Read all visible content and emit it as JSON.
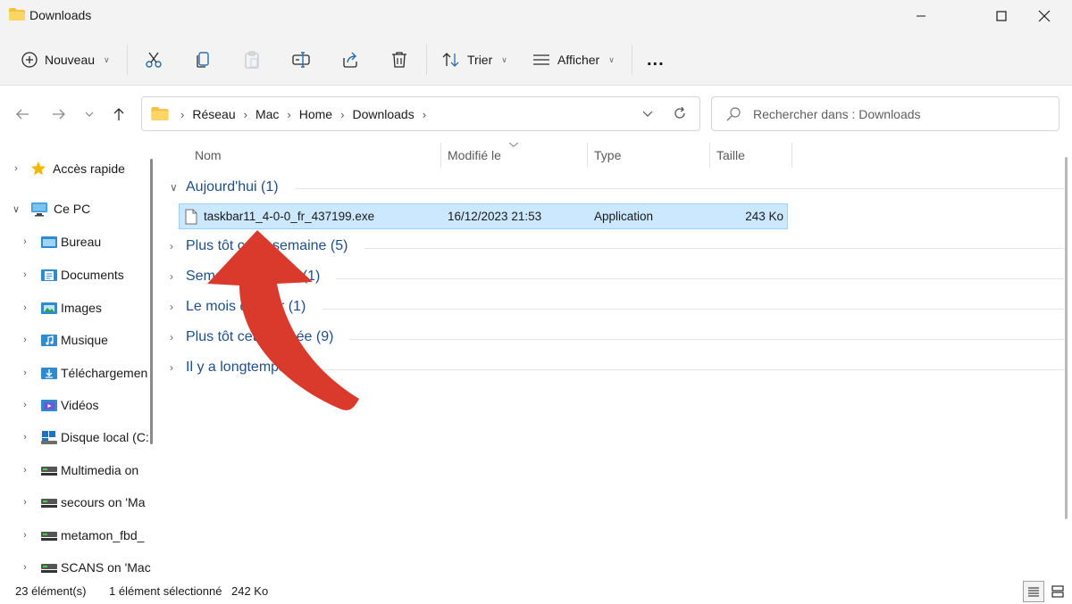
{
  "window": {
    "title": "Downloads",
    "icon": "folder-icon"
  },
  "toolbar": {
    "new_label": "Nouveau",
    "sort_label": "Trier",
    "view_label": "Afficher",
    "more_label": "..."
  },
  "address": {
    "breadcrumbs": [
      "Réseau",
      "Mac",
      "Home",
      "Downloads"
    ]
  },
  "search": {
    "placeholder": "Rechercher dans : Downloads"
  },
  "sidebar": {
    "items": [
      {
        "label": "Accès rapide",
        "icon": "star-icon"
      },
      {
        "label": "Ce PC",
        "icon": "pc-icon"
      },
      {
        "label": "Bureau",
        "icon": "desktop-folder-icon"
      },
      {
        "label": "Documents",
        "icon": "documents-folder-icon"
      },
      {
        "label": "Images",
        "icon": "images-folder-icon"
      },
      {
        "label": "Musique",
        "icon": "music-folder-icon"
      },
      {
        "label": "Téléchargemen",
        "icon": "downloads-folder-icon"
      },
      {
        "label": "Vidéos",
        "icon": "videos-folder-icon"
      },
      {
        "label": "Disque local (C:",
        "icon": "drive-icon"
      },
      {
        "label": "Multimedia on",
        "icon": "network-drive-icon"
      },
      {
        "label": "secours on 'Ma",
        "icon": "network-drive-icon"
      },
      {
        "label": "metamon_fbd_",
        "icon": "network-drive-icon"
      },
      {
        "label": "SCANS on 'Mac",
        "icon": "network-drive-icon"
      }
    ]
  },
  "columns": {
    "name": "Nom",
    "modified": "Modifié le",
    "type": "Type",
    "size": "Taille"
  },
  "groups": [
    {
      "label": "Aujourd'hui (1)",
      "expanded": true
    },
    {
      "label": "Plus tôt cette semaine (5)",
      "expanded": false
    },
    {
      "label": "Semaine dernière (1)",
      "expanded": false
    },
    {
      "label": "Le mois dernier (1)",
      "expanded": false
    },
    {
      "label": "Plus tôt cette année (9)",
      "expanded": false
    },
    {
      "label": "Il y a longtemps (5)",
      "expanded": false
    }
  ],
  "files": [
    {
      "name": "taskbar11_4-0-0_fr_437199.exe",
      "modified": "16/12/2023 21:53",
      "type": "Application",
      "size": "243 Ko",
      "selected": true
    }
  ],
  "status": {
    "count": "23 élément(s)",
    "selection": "1 élément sélectionné",
    "selection_size": "242 Ko"
  },
  "colors": {
    "selection_bg": "#cce8ff",
    "group_text": "#1e4e8c",
    "arrow": "#d93a2b"
  }
}
